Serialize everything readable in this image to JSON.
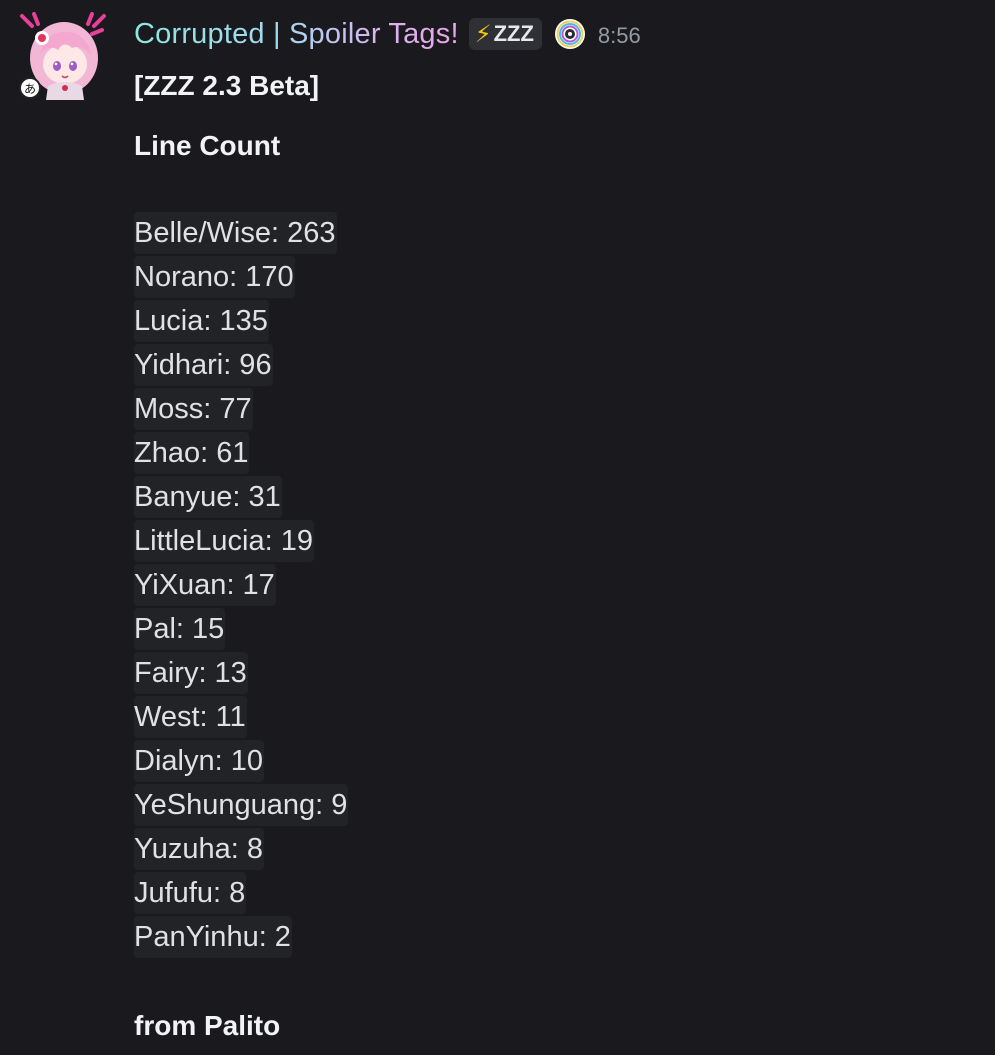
{
  "message": {
    "author": {
      "name": "Corrupted | Spoiler Tags!",
      "tag_icon": "lightning-bolt-icon",
      "tag_label": "ZZZ",
      "badge_icon": "circular-rainbow-badge-icon",
      "timestamp": "8:56"
    },
    "title": "[ZZZ 2.3 Beta]",
    "subtitle": "Line Count",
    "counts": [
      "Belle/Wise: 263",
      "Norano: 170",
      "Lucia: 135",
      "Yidhari: 96",
      "Moss: 77",
      "Zhao: 61",
      "Banyue: 31",
      "LittleLucia: 19",
      "YiXuan: 17",
      "Pal: 15",
      "Fairy: 13",
      "West: 11",
      "Dialyn: 10",
      "YeShunguang: 9",
      "Yuzuha: 8",
      "Jufufu: 8",
      "PanYinhu: 2"
    ],
    "footer": "from Palito"
  },
  "colors": {
    "background": "#1a1a1e",
    "text": "#dbdee1",
    "inline_code_bg": "#222327",
    "timestamp": "#949ba4",
    "tag_bolt": "#f5c518"
  }
}
